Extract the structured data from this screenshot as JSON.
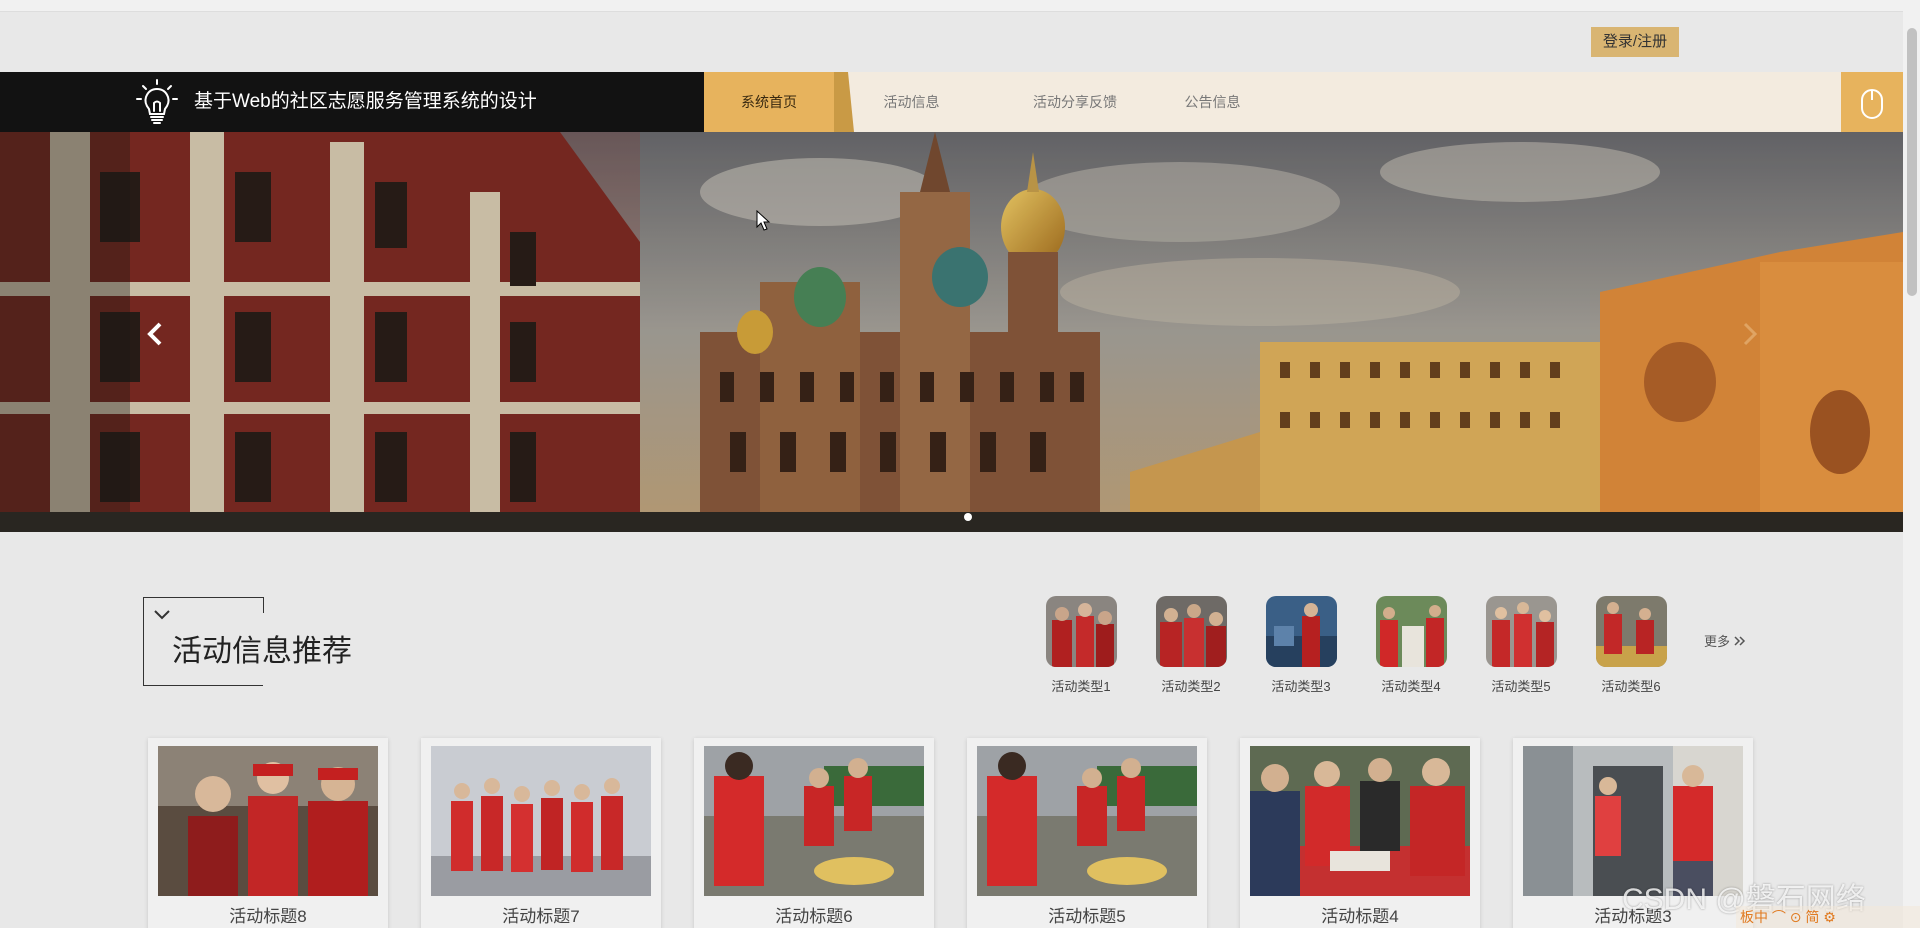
{
  "header": {
    "login_label": "登录/注册",
    "site_title": "基于Web的社区志愿服务管理系统的设计"
  },
  "nav": {
    "items": [
      {
        "label": "系统首页",
        "active": true
      },
      {
        "label": "活动信息",
        "active": false
      },
      {
        "label": "活动分享反馈",
        "active": false
      },
      {
        "label": "公告信息",
        "active": false
      }
    ]
  },
  "icons": {
    "logo": "lightbulb-icon",
    "user": "mouse-icon",
    "prev": "chevron-left-icon",
    "next": "chevron-right-icon",
    "section": "chevron-down-icon",
    "more": "double-chevron-right-icon"
  },
  "colors": {
    "accent": "#e7b35d",
    "nav_bg": "#f3ebdf",
    "brand_bg": "#121212",
    "login_bg": "#d9b572"
  },
  "section": {
    "title": "活动信息推荐",
    "more_label": "更多"
  },
  "categories": [
    {
      "label": "活动类型1"
    },
    {
      "label": "活动类型2"
    },
    {
      "label": "活动类型3"
    },
    {
      "label": "活动类型4"
    },
    {
      "label": "活动类型5"
    },
    {
      "label": "活动类型6"
    }
  ],
  "cards": [
    {
      "title": "活动标题8"
    },
    {
      "title": "活动标题7"
    },
    {
      "title": "活动标题6"
    },
    {
      "title": "活动标题5"
    },
    {
      "title": "活动标题4"
    },
    {
      "title": "活动标题3"
    }
  ],
  "watermark": "CSDN @磐石网络",
  "ime_bar": "板中 ⌒ ⊙ 简 ⚙"
}
